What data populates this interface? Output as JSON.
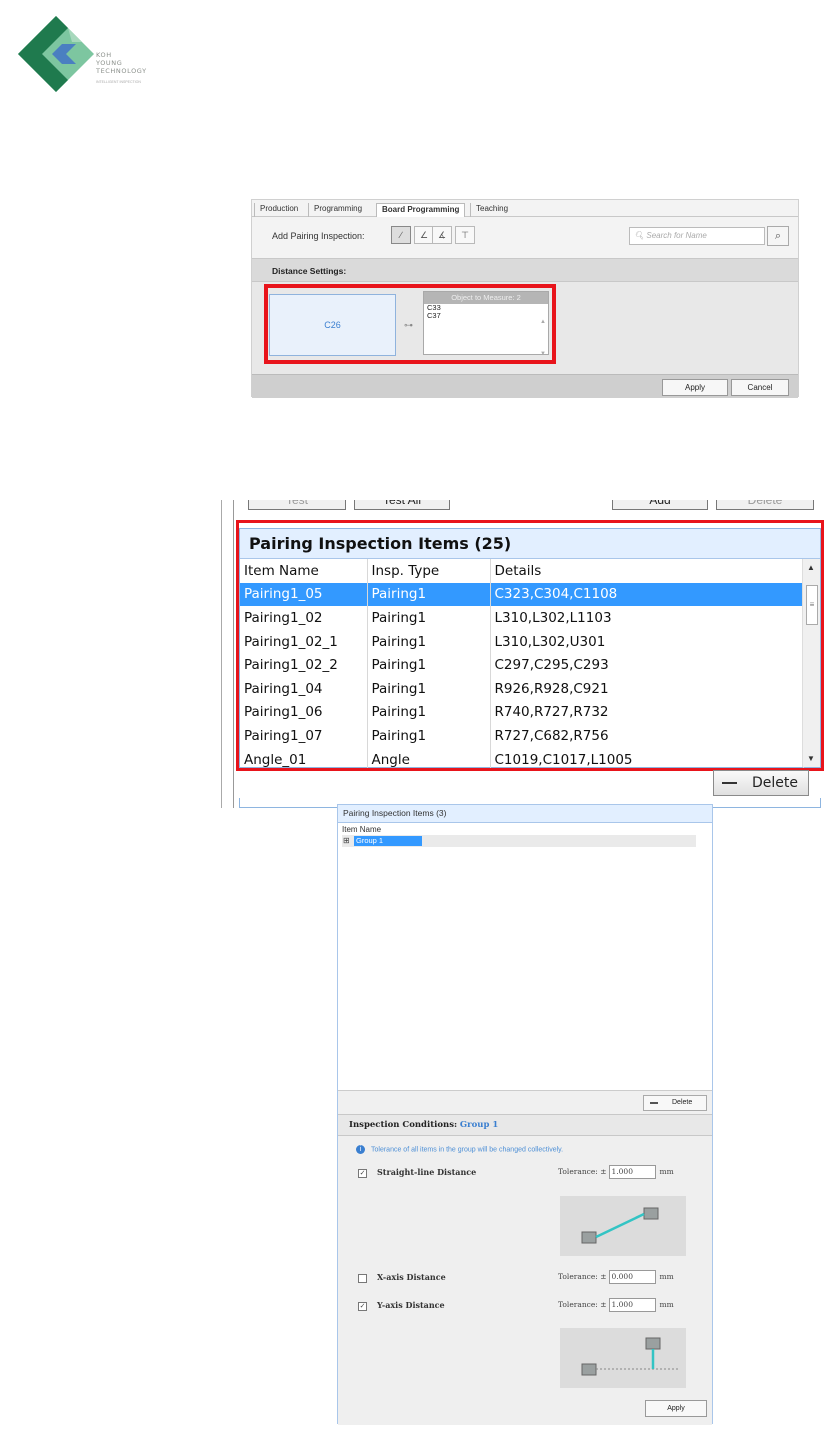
{
  "logo": {
    "brand_lines": [
      "KOH",
      "YOUNG",
      "TECHNOLOGY"
    ],
    "tagline": "INTELLIGENT INSPECTION",
    "colors": {
      "light_green": "#7dc6a0",
      "dark_green": "#1f7a4e",
      "blue": "#4a7fc1"
    }
  },
  "shot1": {
    "tabs": [
      "Production",
      "Programming",
      "Board Programming",
      "Teaching"
    ],
    "add_label": "Add Pairing Inspection:",
    "tool_icons": [
      "distance-icon",
      "angle-icon",
      "angle2-icon",
      "multi-distance-icon"
    ],
    "search_placeholder": "Search for Name",
    "section_title": "Distance Settings:",
    "reference": "C26",
    "measure_header": "Object to Measure: 2",
    "measure_items": [
      "C33",
      "C37"
    ],
    "apply": "Apply",
    "cancel": "Cancel"
  },
  "shot2": {
    "top_buttons": [
      "Test",
      "Test All",
      "Add",
      "Delete"
    ],
    "title": "Pairing Inspection Items (25)",
    "columns": [
      "Item Name",
      "Insp. Type",
      "Details"
    ],
    "rows": [
      [
        "Pairing1_05",
        "Pairing1",
        "C323,C304,C1108"
      ],
      [
        "Pairing1_02",
        "Pairing1",
        "L310,L302,L1103"
      ],
      [
        "Pairing1_02_1",
        "Pairing1",
        "L310,L302,U301"
      ],
      [
        "Pairing1_02_2",
        "Pairing1",
        "C297,C295,C293"
      ],
      [
        "Pairing1_04",
        "Pairing1",
        "R926,R928,C921"
      ],
      [
        "Pairing1_06",
        "Pairing1",
        "R740,R727,R732"
      ],
      [
        "Pairing1_07",
        "Pairing1",
        "R727,C682,R756"
      ],
      [
        "Angle_01",
        "Angle",
        "C1019,C1017,L1005"
      ]
    ],
    "selected_row": 0,
    "delete": "Delete"
  },
  "shot3": {
    "title": "Pairing Inspection Items (3)",
    "col_header": "Item Name",
    "group_expander": "⊞",
    "group_name": "Group 1",
    "delete": "Delete",
    "conditions_label": "Inspection Conditions:",
    "conditions_group": "Group 1",
    "info_text": "Tolerance of all items in the group will be changed collectively.",
    "options": [
      {
        "label": "Straight-line Distance",
        "checked": true,
        "tolerance": "1.000"
      },
      {
        "label": "X-axis Distance",
        "checked": false,
        "tolerance": "0.000"
      },
      {
        "label": "Y-axis Distance",
        "checked": true,
        "tolerance": "1.000"
      }
    ],
    "tolerance_label": "Tolerance: ±",
    "unit": "mm",
    "apply": "Apply"
  }
}
